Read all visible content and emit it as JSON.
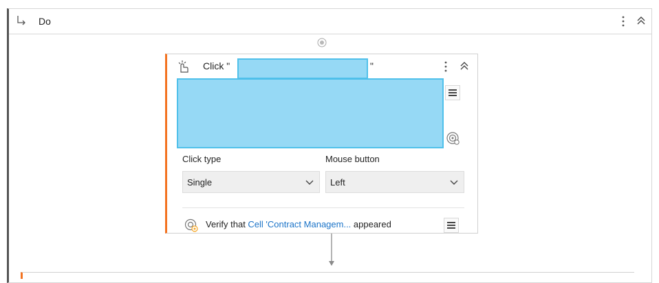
{
  "do_block": {
    "title": "Do",
    "arrow_icon": "return-arrow-icon",
    "more_icon": "kebab-menu-icon",
    "collapse_icon": "chevron-up-double-icon"
  },
  "click_activity": {
    "title_prefix": "Click \"",
    "title_suffix": "\"",
    "icon": "click-hand-icon",
    "more_icon": "kebab-menu-icon",
    "collapse_icon": "chevron-up-double-icon",
    "target_menu_icon": "hamburger-menu-icon",
    "target_indicator_icon": "target-icon",
    "click_type": {
      "label": "Click type",
      "value": "Single"
    },
    "mouse_button": {
      "label": "Mouse button",
      "value": "Left"
    },
    "verify": {
      "prefix": "Verify that ",
      "link": "Cell 'Contract Managem...",
      "suffix": " appeared",
      "icon": "verify-target-icon",
      "menu_icon": "hamburger-menu-icon"
    }
  },
  "colors": {
    "accent_orange": "#f37321",
    "redaction_fill": "#96d9f5",
    "link_blue": "#1a73c8"
  }
}
